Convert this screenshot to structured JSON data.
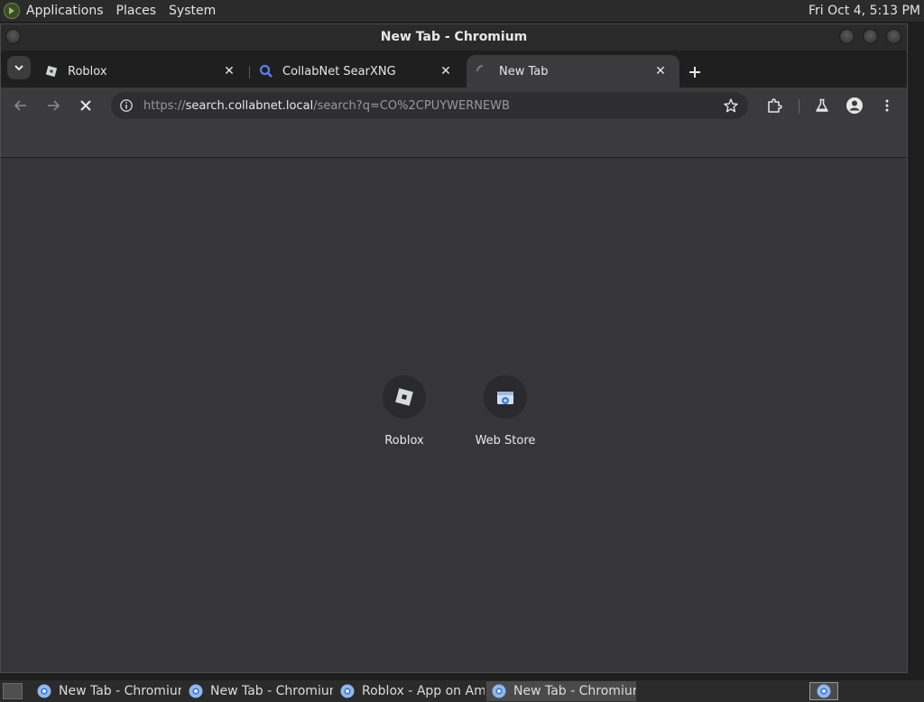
{
  "top_panel": {
    "menus": [
      "Applications",
      "Places",
      "System"
    ],
    "clock": "Fri Oct  4,  5:13 PM"
  },
  "window": {
    "title": "New Tab - Chromium"
  },
  "tabs": [
    {
      "title": "Roblox",
      "icon": "roblox-icon"
    },
    {
      "title": "CollabNet SearXNG",
      "icon": "search-icon"
    },
    {
      "title": "New Tab",
      "icon": "loading-spinner-icon",
      "active": true
    }
  ],
  "toolbar": {
    "url_scheme": "https://",
    "url_host": "search.collabnet.local",
    "url_path": "/search?q=CO%2CPUYWERNEWB"
  },
  "shortcuts": [
    {
      "label": "Roblox",
      "icon": "roblox-icon"
    },
    {
      "label": "Web Store",
      "icon": "web-store-icon"
    }
  ],
  "taskbar": {
    "tasks": [
      {
        "label": "New Tab - Chromium",
        "active": false
      },
      {
        "label": "New Tab - Chromium",
        "active": false
      },
      {
        "label": "Roblox - App on Am…",
        "active": false
      },
      {
        "label": "New Tab - Chromium",
        "active": true
      }
    ]
  },
  "colors": {
    "content_bg": "#36363a",
    "toolbar_bg": "#3b3b3e",
    "search_icon": "#5b7cf0"
  }
}
